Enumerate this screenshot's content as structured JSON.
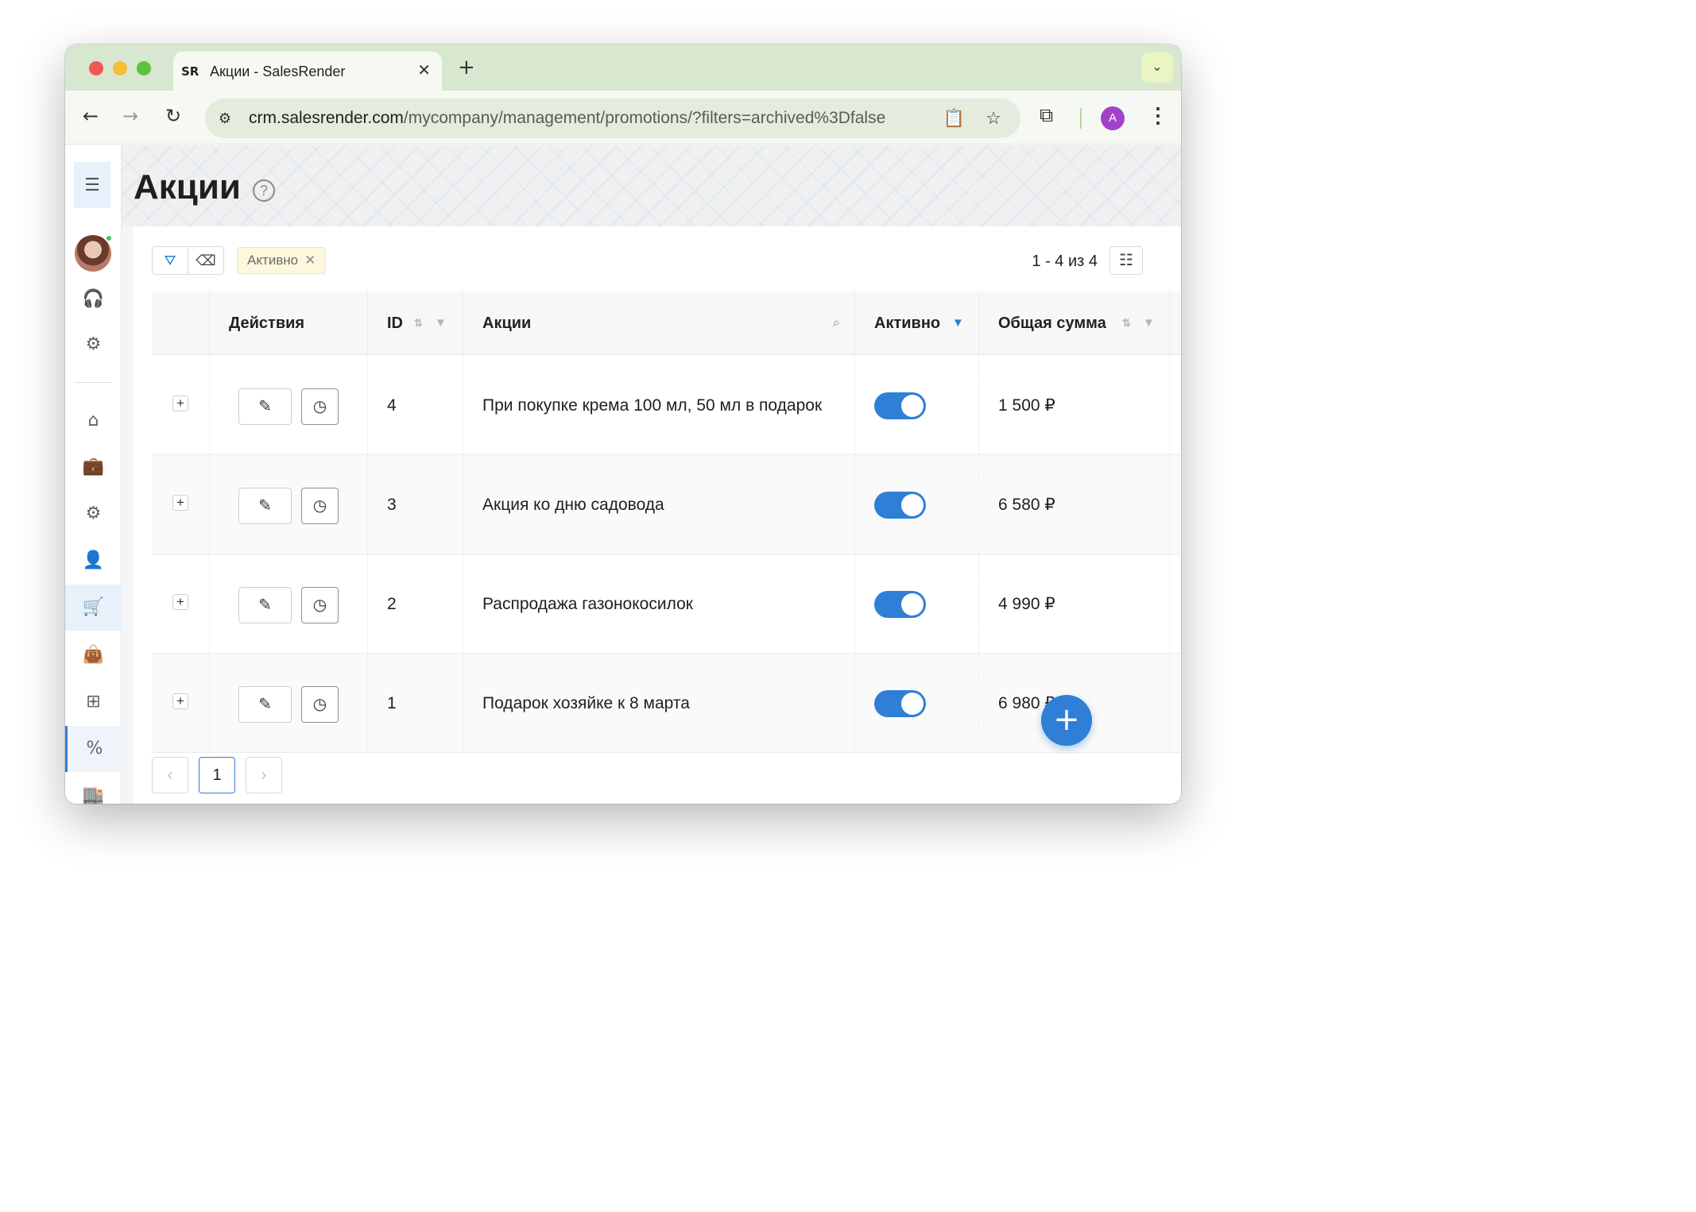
{
  "browser": {
    "tab_title": "Акции - SalesRender",
    "tab_favicon": "SR",
    "url_host": "crm.salesrender.com",
    "url_path": "/mycompany/management/promotions/?filters=archived%3Dfalse",
    "profile_initial": "A"
  },
  "page": {
    "title": "Акции",
    "help": "?"
  },
  "filters": {
    "chip_label": "Активно",
    "counter": "1 - 4 из 4"
  },
  "table": {
    "columns": {
      "actions": "Действия",
      "id": "ID",
      "name": "Акции",
      "active": "Активно",
      "total": "Общая сумма"
    },
    "rows": [
      {
        "id": "4",
        "name": "При покупке крема 100 мл, 50 мл в подарок",
        "active": true,
        "total": "1 500 ₽"
      },
      {
        "id": "3",
        "name": "Акция ко дню садовода",
        "active": true,
        "total": "6 580 ₽"
      },
      {
        "id": "2",
        "name": "Распродажа газонокосилок",
        "active": true,
        "total": "4 990 ₽"
      },
      {
        "id": "1",
        "name": "Подарок хозяйке к 8 марта",
        "active": true,
        "total": "6 980 ₽"
      }
    ]
  },
  "pagination": {
    "current_page": "1"
  },
  "icons": {
    "accent_color": "#2f7fd6"
  }
}
